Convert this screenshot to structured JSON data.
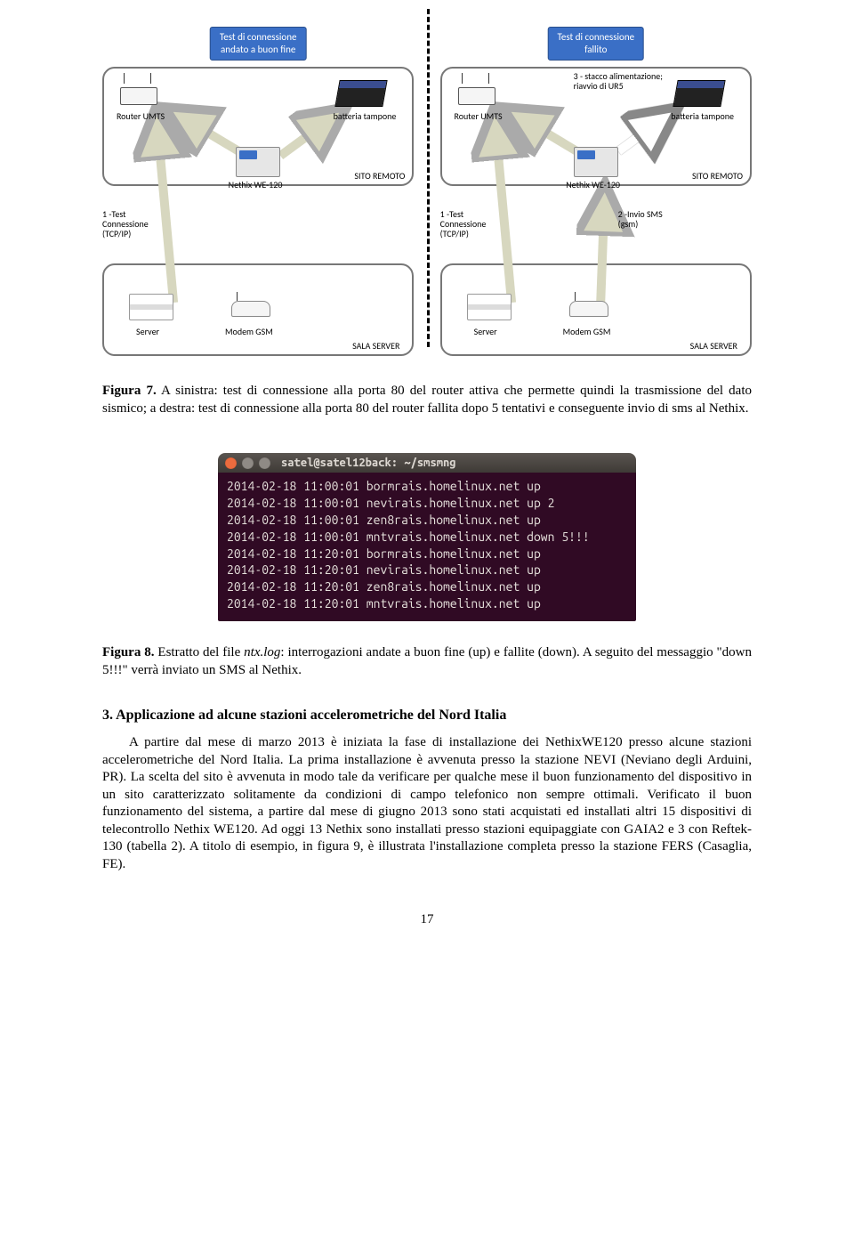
{
  "diagram": {
    "left": {
      "title": "Test di connessione\nandato a buon fine",
      "router_label": "Router UMTS",
      "battery_label": "batteria tampone",
      "nethix_label": "Nethix WE-120",
      "sito": "SITO REMOTO",
      "test1": "1 -Test\nConnessione\n(TCP/IP)",
      "server_label": "Server",
      "modem_label": "Modem GSM",
      "sala": "SALA SERVER"
    },
    "right": {
      "title": "Test di connessione\nfallito",
      "router_label": "Router UMTS",
      "battery_label": "batteria tampone",
      "nethix_label": "Nethix WE-120",
      "sito": "SITO REMOTO",
      "test1": "1 -Test\nConnessione\n(TCP/IP)",
      "sms": "2 -Invio SMS\n(gsm)",
      "stacco": "3 - stacco alimentazione;\nriavvio di UR5",
      "server_label": "Server",
      "modem_label": "Modem GSM",
      "sala": "SALA SERVER"
    }
  },
  "caption7": {
    "label": "Figura 7.",
    "text": " A sinistra: test di connessione alla porta 80 del router attiva che permette quindi la trasmissione del dato sismico; a destra: test di connessione alla porta 80 del router fallita dopo 5 tentativi e conseguente invio di sms al Nethix."
  },
  "terminal": {
    "title": "satel@satel12back: ~/smsmng",
    "lines": [
      "2014-02-18 11:00:01 bormrais.homelinux.net up",
      "2014-02-18 11:00:01 nevirais.homelinux.net up 2",
      "2014-02-18 11:00:01 zen8rais.homelinux.net up",
      "2014-02-18 11:00:01 mntvrais.homelinux.net down 5!!!",
      "2014-02-18 11:20:01 bormrais.homelinux.net up",
      "2014-02-18 11:20:01 nevirais.homelinux.net up",
      "2014-02-18 11:20:01 zen8rais.homelinux.net up",
      "2014-02-18 11:20:01 mntvrais.homelinux.net up"
    ]
  },
  "caption8": {
    "label": "Figura 8.",
    "text_pre": " Estratto del file ",
    "ital": "ntx.log",
    "text_post": ": interrogazioni andate a buon fine (up) e fallite (down). A seguito del messaggio \"down 5!!!\" verrà inviato un SMS al Nethix."
  },
  "section": {
    "heading": "3. Applicazione ad alcune stazioni accelerometriche del Nord Italia",
    "body": "A partire dal mese di marzo 2013 è iniziata la fase di installazione dei NethixWE120 presso alcune stazioni accelerometriche del Nord Italia. La prima installazione è avvenuta presso la stazione NEVI (Neviano degli Arduini, PR). La scelta del sito è avvenuta in modo tale da verificare per qualche mese il buon funzionamento del dispositivo in un sito caratterizzato solitamente da condizioni di campo telefonico non sempre ottimali. Verificato il buon funzionamento del sistema, a partire dal mese di giugno 2013 sono stati acquistati ed installati altri 15 dispositivi di telecontrollo Nethix WE120. Ad oggi 13 Nethix sono installati presso stazioni equipaggiate con GAIA2 e 3 con Reftek-130 (tabella 2). A titolo di esempio, in figura 9, è illustrata l'installazione completa presso la stazione FERS (Casaglia, FE)."
  },
  "pagenum": "17"
}
